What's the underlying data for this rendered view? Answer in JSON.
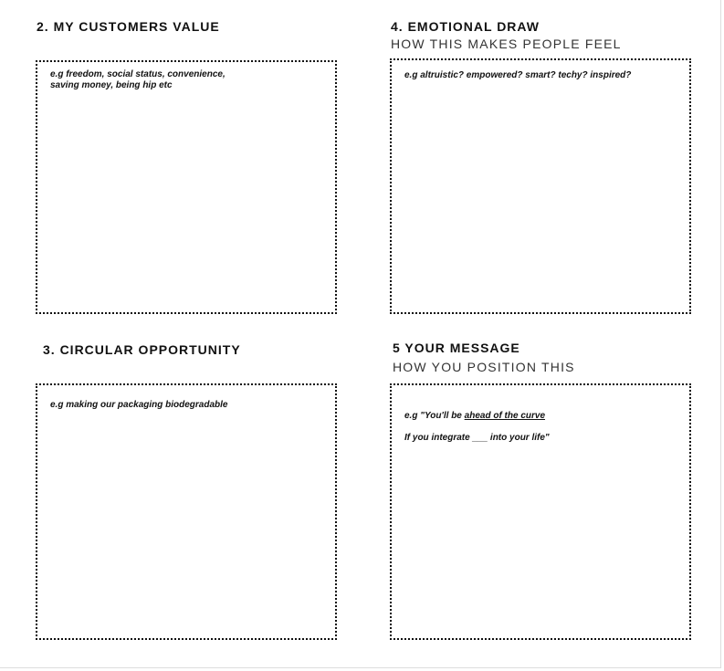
{
  "sections": {
    "customers_value": {
      "title": "2. MY CUSTOMERS VALUE",
      "hint": "e.g freedom, social status, convenience,\nsaving money, being hip etc"
    },
    "emotional_draw": {
      "title": "4. EMOTIONAL DRAW",
      "subtitle": "HOW THIS MAKES PEOPLE FEEL",
      "hint": "e.g altruistic? empowered? smart? techy? inspired?"
    },
    "circular_opportunity": {
      "title": "3. CIRCULAR OPPORTUNITY",
      "hint": "e.g making our packaging biodegradable"
    },
    "your_message": {
      "title": "5 YOUR MESSAGE",
      "subtitle": "HOW YOU POSITION THIS",
      "hint_prefix": "e.g \"You'll be ",
      "hint_underlined": "ahead of the curve ",
      "hint_line2": "If you integrate ___ into your life\""
    }
  }
}
